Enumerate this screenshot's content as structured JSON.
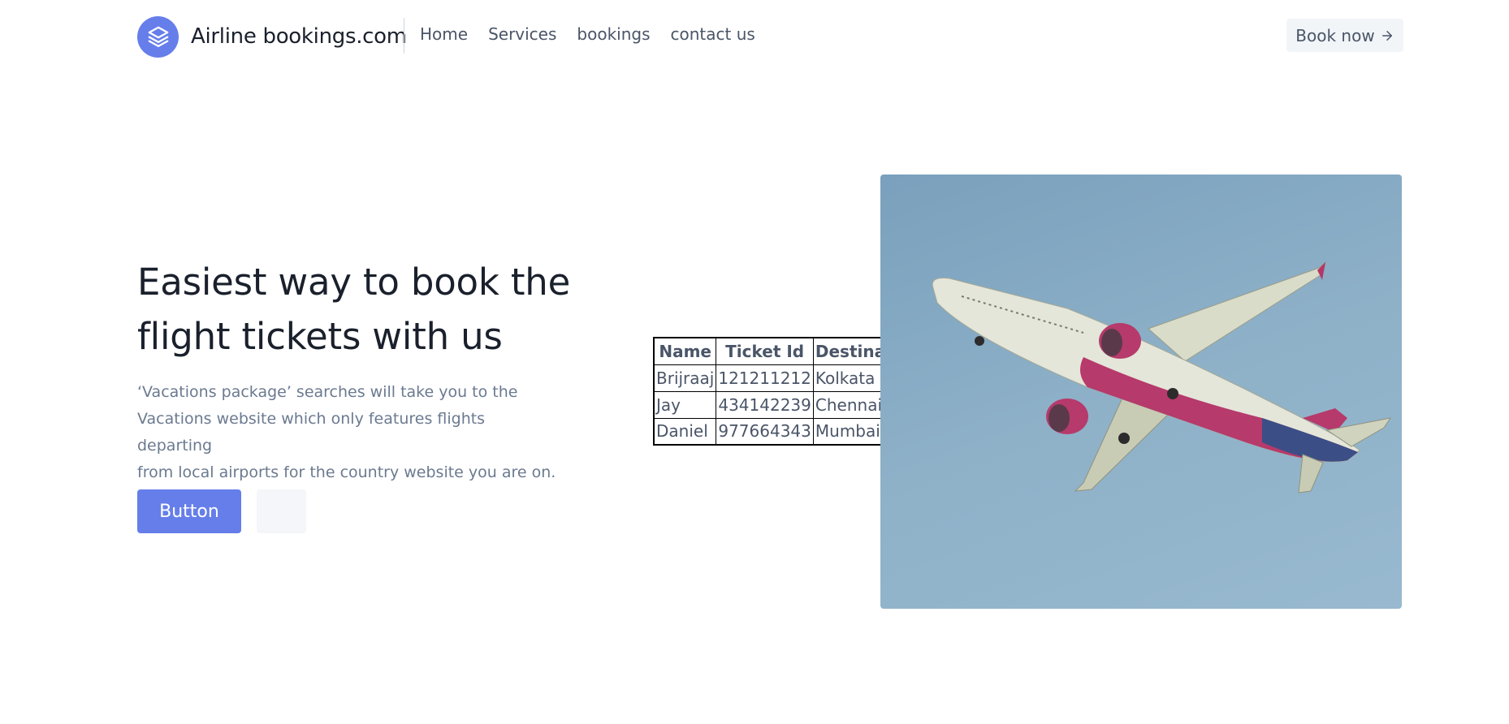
{
  "header": {
    "brand": "Airline bookings.com",
    "nav": [
      "Home",
      "Services",
      "bookings",
      "contact us"
    ],
    "cta_label": "Book now",
    "cta_icon": "arrow-right-icon",
    "logo_icon": "stack-layers-icon"
  },
  "hero": {
    "title_line1": "Easiest way to book the",
    "title_line2": "flight tickets with us",
    "description_line1": "‘Vacations package’ searches will take you to the",
    "description_line2": "Vacations website which only features flights departing",
    "description_line3": "from local airports for the country website you are on.",
    "primary_button": "Button",
    "secondary_button": ""
  },
  "table": {
    "headers": [
      "Name",
      "Ticket Id",
      "Destination"
    ],
    "rows": [
      [
        "Brijraaj",
        "121211212",
        "Kolkata"
      ],
      [
        "Jay",
        "434142239",
        "Chennai"
      ],
      [
        "Daniel",
        "977664343",
        "Mumbai"
      ]
    ]
  },
  "image": {
    "subject": "airplane-photo"
  },
  "colors": {
    "accent": "#667eea",
    "text_dark": "#1a202c",
    "text_muted": "#6b7a90",
    "sky": "#8cb0c7"
  }
}
